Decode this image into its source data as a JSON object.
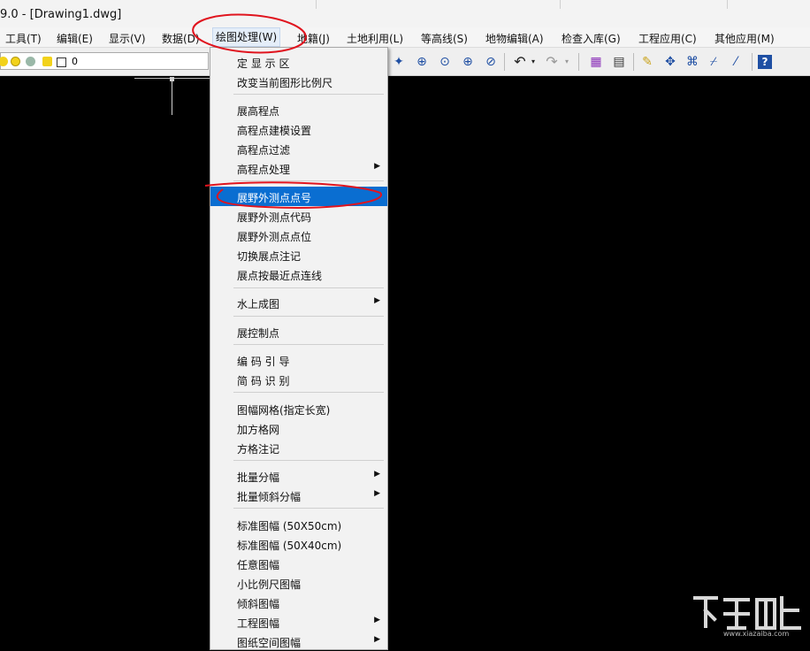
{
  "window": {
    "title": "9.0 - [Drawing1.dwg]"
  },
  "menubar": {
    "items": [
      {
        "label": "工具(T)"
      },
      {
        "label": "编辑(E)"
      },
      {
        "label": "显示(V)"
      },
      {
        "label": "数据(D)"
      },
      {
        "label": "绘图处理(W)",
        "active": true
      },
      {
        "label": "地籍(J)"
      },
      {
        "label": "土地利用(L)"
      },
      {
        "label": "等高线(S)"
      },
      {
        "label": "地物编辑(A)"
      },
      {
        "label": "检查入库(G)"
      },
      {
        "label": "工程应用(C)"
      },
      {
        "label": "其他应用(M)"
      }
    ]
  },
  "toolbar": {
    "layer_value": "0",
    "icons": [
      "zoom-extents-icon",
      "zoom-realtime-icon",
      "zoom-window-icon",
      "zoom-in-icon",
      "zoom-previous-icon",
      "undo-icon",
      "undo-dropdown-icon",
      "redo-icon",
      "redo-dropdown-icon",
      "layer-manager-icon",
      "properties-icon",
      "pencil-icon",
      "move-icon",
      "node-edit-icon",
      "trim-icon",
      "extend-icon",
      "help-icon"
    ]
  },
  "dropdown": {
    "items": [
      {
        "label": "定 显 示 区"
      },
      {
        "label": "改变当前图形比例尺"
      },
      {
        "label": "展高程点"
      },
      {
        "label": "高程点建模设置"
      },
      {
        "label": "高程点过滤"
      },
      {
        "label": "高程点处理",
        "submenu": true
      },
      {
        "label": "展野外测点点号",
        "highlighted": true
      },
      {
        "label": "展野外测点代码"
      },
      {
        "label": "展野外测点点位"
      },
      {
        "label": "切换展点注记"
      },
      {
        "label": "展点按最近点连线"
      },
      {
        "label": "水上成图",
        "submenu": true
      },
      {
        "label": "展控制点"
      },
      {
        "label": "编 码 引 导"
      },
      {
        "label": "简 码 识 别"
      },
      {
        "label": "图幅网格(指定长宽)"
      },
      {
        "label": "加方格网"
      },
      {
        "label": "方格注记"
      },
      {
        "label": "批量分幅",
        "submenu": true
      },
      {
        "label": "批量倾斜分幅",
        "submenu": true
      },
      {
        "label": "标准图幅 (50X50cm)"
      },
      {
        "label": "标准图幅 (50X40cm)"
      },
      {
        "label": "任意图幅"
      },
      {
        "label": "小比例尺图幅"
      },
      {
        "label": "倾斜图幅"
      },
      {
        "label": "工程图幅",
        "submenu": true
      },
      {
        "label": "图纸空间图幅",
        "submenu": true
      }
    ]
  },
  "watermark": {
    "text": "www.xiazaiba.com"
  },
  "colors": {
    "highlight": "#0a6ed1",
    "annotation": "#e0141e",
    "canvas": "#000000"
  }
}
